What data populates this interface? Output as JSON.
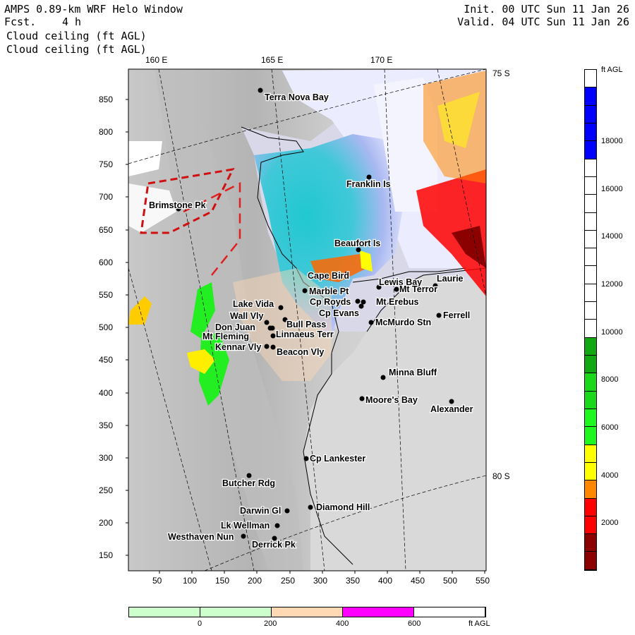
{
  "header": {
    "title": "AMPS 0.89-km WRF Helo Window",
    "forecast_label": "Fcst.",
    "forecast_value": "4 h",
    "field1": "Cloud ceiling (ft AGL)",
    "field2": "Cloud ceiling (ft AGL)",
    "init": "Init. 00 UTC Sun 11 Jan 26",
    "valid": "Valid. 04 UTC Sun 11 Jan 26"
  },
  "longitude_labels": [
    "160 E",
    "165 E",
    "170 E"
  ],
  "latitude_labels": [
    "75 S",
    "80 S"
  ],
  "x_ticks": [
    "50",
    "100",
    "150",
    "200",
    "250",
    "300",
    "350",
    "400",
    "450",
    "500",
    "550"
  ],
  "y_ticks": [
    "850",
    "800",
    "750",
    "700",
    "650",
    "600",
    "550",
    "500",
    "450",
    "400",
    "350",
    "300",
    "250",
    "200",
    "150"
  ],
  "stations": [
    {
      "name": "Terra Nova Bay"
    },
    {
      "name": "Franklin Is"
    },
    {
      "name": "Brimstone Pk"
    },
    {
      "name": "Beaufort Is"
    },
    {
      "name": "Cape Bird"
    },
    {
      "name": "Lewis Bay"
    },
    {
      "name": "Laurie"
    },
    {
      "name": "Mt Terror"
    },
    {
      "name": "Marble Pt"
    },
    {
      "name": "Cp Royds"
    },
    {
      "name": "Mt Erebus"
    },
    {
      "name": "Lake Vida"
    },
    {
      "name": "Cp Evans"
    },
    {
      "name": "Ferrell"
    },
    {
      "name": "Wall Vly"
    },
    {
      "name": "Bull Pass"
    },
    {
      "name": "McMurdo Stn"
    },
    {
      "name": "Don Juan"
    },
    {
      "name": "Linnaeus Terr"
    },
    {
      "name": "Mt Fleming"
    },
    {
      "name": "Kennar Vly"
    },
    {
      "name": "Beacon Vly"
    },
    {
      "name": "Minna Bluff"
    },
    {
      "name": "Moore's Bay"
    },
    {
      "name": "Alexander"
    },
    {
      "name": "Cp Lankester"
    },
    {
      "name": "Butcher Rdg"
    },
    {
      "name": "Darwin Gl"
    },
    {
      "name": "Diamond Hill"
    },
    {
      "name": "Lk Wellman"
    },
    {
      "name": "Westhaven Nun"
    },
    {
      "name": "Derrick Pk"
    }
  ],
  "right_colorbar": {
    "unit": "ft AGL",
    "labels": [
      "18000",
      "16000",
      "14000",
      "12000",
      "10000",
      "8000",
      "6000",
      "4000",
      "2000"
    ],
    "colors": [
      "#ffffff",
      "#0000ff",
      "#0000ff",
      "#0000ff",
      "#0000ff",
      "#ffffff",
      "#ffffff",
      "#ffffff",
      "#ffffff",
      "#ffffff",
      "#ffffff",
      "#ffffff",
      "#ffffff",
      "#ffffff",
      "#ffffff",
      "#11a811",
      "#11a811",
      "#1ad81a",
      "#1ad81a",
      "#1ff81f",
      "#1ff81f",
      "#ffff00",
      "#ffff00",
      "#ff8800",
      "#ff0000",
      "#ff0000",
      "#8b0000",
      "#8b0000"
    ]
  },
  "bottom_colorbar": {
    "unit": "ft AGL",
    "labels": [
      "0",
      "200",
      "400",
      "600"
    ],
    "colors": [
      "#ccffcc",
      "#ccffcc",
      "#ffd9b3",
      "#ff00ff",
      "#ffffff"
    ]
  }
}
